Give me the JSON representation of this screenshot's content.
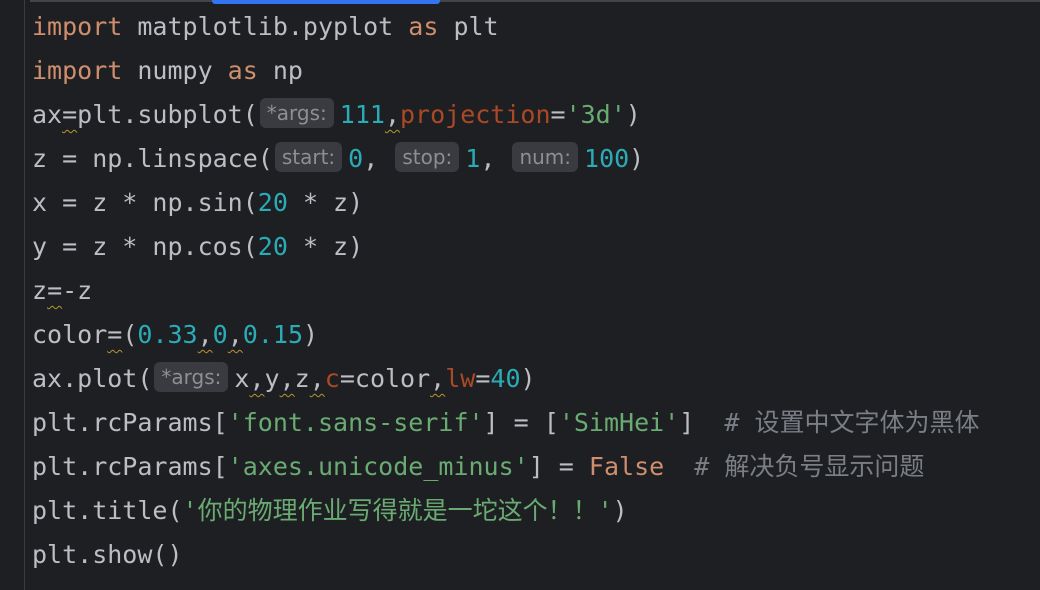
{
  "lines": [
    {
      "a": "import",
      "b": " matplotlib.pyplot ",
      "c": "as",
      "d": " plt"
    },
    {
      "a": "import",
      "b": " numpy ",
      "c": "as",
      "d": " np"
    },
    {
      "a": "ax",
      "b": "=",
      "c": "plt.subplot(",
      "hint": "*args:",
      "d": "111",
      "e": ",",
      "f": "projection",
      "g": "=",
      "h": "'3d'",
      "i": ")"
    },
    {
      "a": "z = np.linspace(",
      "hint1": "start:",
      "b": "0",
      "c": ", ",
      "hint2": "stop:",
      "d": "1",
      "e": ", ",
      "hint3": "num:",
      "f": "100",
      "g": ")"
    },
    {
      "a": "x = z * np.sin(",
      "b": "20",
      "c": " * z)"
    },
    {
      "a": "y = z * np.cos(",
      "b": "20",
      "c": " * z)"
    },
    {
      "a": "z",
      "b": "=",
      "c": "-z"
    },
    {
      "a": "color",
      "b": "=",
      "c": "(",
      "d": "0.33",
      "e": ",",
      "f": "0",
      "g": ",",
      "h": "0.15",
      "i": ")"
    },
    {
      "a": "ax.plot(",
      "hint": "*args:",
      "b": "x",
      "c": ",",
      "d": "y",
      "e": ",",
      "f": "z",
      "g": ",",
      "h": "c",
      "i": "=color",
      "j": ",",
      "k": "lw",
      "l": "=",
      "m": "40",
      "n": ")"
    },
    {
      "a": "plt.rcParams[",
      "b": "'font.sans-serif'",
      "c": "] = [",
      "d": "'SimHei'",
      "e": "]  ",
      "f": "# 设置中文字体为黑体"
    },
    {
      "a": "plt.rcParams[",
      "b": "'axes.unicode_minus'",
      "c": "] = ",
      "d": "False",
      "e": "  ",
      "f": "# 解决负号显示问题"
    },
    {
      "a": "plt.title(",
      "b": "'你的物理作业写得就是一坨这个！！'",
      "c": ")"
    },
    {
      "a": "plt.show()"
    }
  ]
}
